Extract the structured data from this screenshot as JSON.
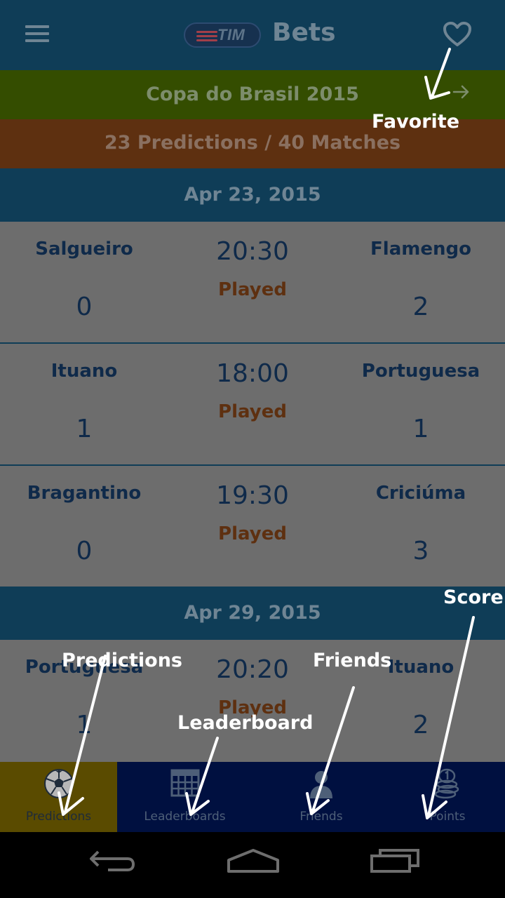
{
  "header": {
    "logo_text": "TIM",
    "title": "Bets",
    "favorite_icon": "heart-outline-icon",
    "menu_icon": "hamburger-menu-icon"
  },
  "competition": {
    "title": "Copa do Brasil 2015",
    "arrow_icon": "arrow-right-icon"
  },
  "summary": {
    "text": "23 Predictions / 40 Matches"
  },
  "dates": [
    {
      "label": "Apr 23, 2015"
    },
    {
      "label": "Apr 29, 2015"
    }
  ],
  "matches": [
    {
      "home": "Salgueiro",
      "away": "Flamengo",
      "time": "20:30",
      "status": "Played",
      "home_score": "0",
      "away_score": "2"
    },
    {
      "home": "Ituano",
      "away": "Portuguesa",
      "time": "18:00",
      "status": "Played",
      "home_score": "1",
      "away_score": "1"
    },
    {
      "home": "Bragantino",
      "away": "Criciúma",
      "time": "19:30",
      "status": "Played",
      "home_score": "0",
      "away_score": "3"
    },
    {
      "home": "Portuguesa",
      "away": "Ituano",
      "time": "20:20",
      "status": "Played",
      "home_score": "1",
      "away_score": "2"
    }
  ],
  "bottom_nav": [
    {
      "label": "Predictions",
      "icon": "soccer-ball-icon",
      "active": true
    },
    {
      "label": "Leaderboards",
      "icon": "grid-table-icon",
      "active": false
    },
    {
      "label": "Friends",
      "icon": "person-icon",
      "active": false
    },
    {
      "label": "Points",
      "icon": "coin-stack-icon",
      "active": false
    }
  ],
  "system_nav": {
    "back_icon": "back-arrow-icon",
    "home_icon": "home-icon",
    "recents_icon": "recents-icon"
  },
  "annotations": {
    "favorite": "Favorite",
    "score": "Score",
    "predictions": "Predictions",
    "friends": "Friends",
    "leaderboard": "Leaderboard"
  },
  "colors": {
    "header_bg": "#0f3d57",
    "competition_bg": "#344d00",
    "summary_bg": "#5e3010",
    "active_tab_bg": "#5a4b00",
    "nav_bg": "#001040",
    "team_text": "#0f2a4a",
    "status_text": "#5e3010",
    "annotation": "#ffffff"
  }
}
